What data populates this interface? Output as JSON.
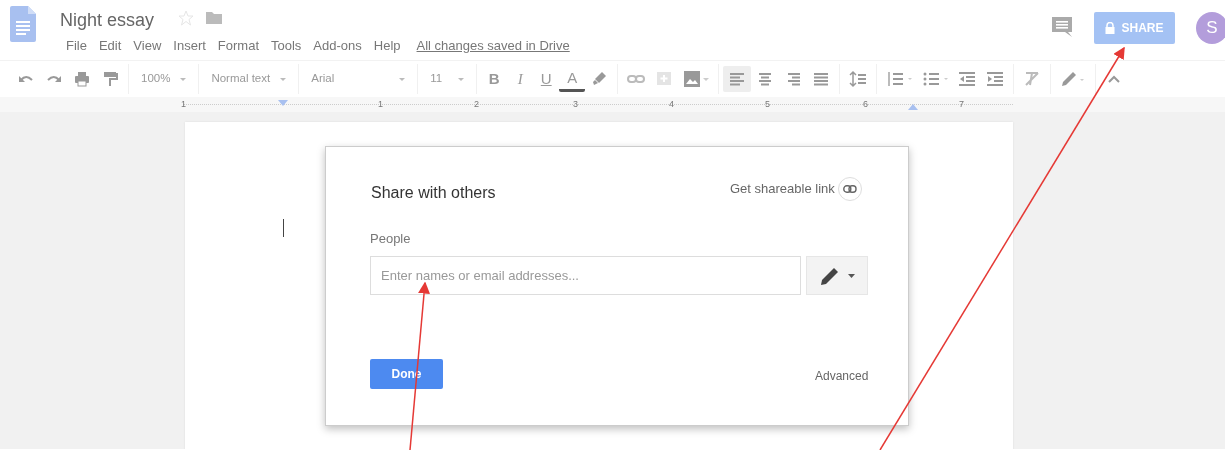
{
  "document": {
    "title": "Night essay",
    "starred": false
  },
  "menu": [
    "File",
    "Edit",
    "View",
    "Insert",
    "Format",
    "Tools",
    "Add-ons",
    "Help"
  ],
  "save_status": "All changes saved in Drive",
  "share_button": {
    "label": "SHARE"
  },
  "avatar": {
    "initial": "S",
    "color": "#b39ddb"
  },
  "toolbar": {
    "dropdowns": [
      {
        "label": "100%"
      },
      {
        "label": "Normal text"
      },
      {
        "label": "Arial"
      },
      {
        "label": "11"
      }
    ],
    "format_buttons": [
      {
        "kind": "bold",
        "label": "B"
      },
      {
        "kind": "italic",
        "label": "I"
      },
      {
        "kind": "underline",
        "label": "U"
      },
      {
        "kind": "text-color",
        "label": "A"
      }
    ],
    "alignments": [
      {
        "kind": "left",
        "selected": true
      },
      {
        "kind": "center",
        "selected": false
      },
      {
        "kind": "right",
        "selected": false
      },
      {
        "kind": "justify",
        "selected": false
      }
    ]
  },
  "ruler_labels": [
    "1",
    "1",
    "2",
    "3",
    "4",
    "5",
    "6",
    "7"
  ],
  "dialog": {
    "title": "Share with others",
    "link_label": "Get shareable link",
    "people_label": "People",
    "input": {
      "placeholder": "Enter names or email addresses..."
    },
    "done_button": "Done",
    "advanced_link": "Advanced"
  }
}
